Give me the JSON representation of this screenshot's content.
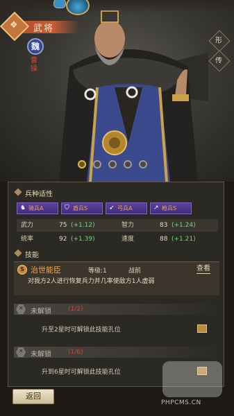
{
  "header": {
    "title": "武将"
  },
  "hero": {
    "faction": "魏",
    "name": "曹操",
    "side_buttons": [
      "形",
      "传"
    ],
    "page_dots": 5,
    "active_dot": 0
  },
  "troops": {
    "heading": "兵种适性",
    "items": [
      {
        "label": "骑兵A",
        "icon": "horse-icon"
      },
      {
        "label": "盾兵S",
        "icon": "shield-icon"
      },
      {
        "label": "弓兵A",
        "icon": "bow-icon"
      },
      {
        "label": "枪兵S",
        "icon": "spear-icon"
      }
    ]
  },
  "stats": [
    {
      "name": "武力",
      "value": "75",
      "bonus": "(+1.12)"
    },
    {
      "name": "智力",
      "value": "83",
      "bonus": "(+1.24)"
    },
    {
      "name": "统率",
      "value": "92",
      "bonus": "(+1.39)"
    },
    {
      "name": "速度",
      "value": "88",
      "bonus": "(+1.21)"
    }
  ],
  "skills": {
    "heading": "技能",
    "main": {
      "badge": "S",
      "name": "治世能臣",
      "level": "等级:1",
      "type": "战前",
      "view": "查看",
      "description": "对我方2人进行恢复兵力并几率使敌方1人虚弱"
    },
    "locked": [
      {
        "title": "未解锁",
        "count": "(1/2)",
        "hint": "升至2星时可解锁此技能孔位"
      },
      {
        "title": "未解锁",
        "count": "(1/6)",
        "hint": "升到6星时可解锁此技能孔位"
      }
    ]
  },
  "footer": {
    "back": "返回"
  },
  "watermark": {
    "text": "PHPCMS.CN"
  },
  "colors": {
    "accent": "#f0a947",
    "bonus": "#7fd07f",
    "troop_bg": "#4f3a8e",
    "lock_count": "#d2443a"
  }
}
